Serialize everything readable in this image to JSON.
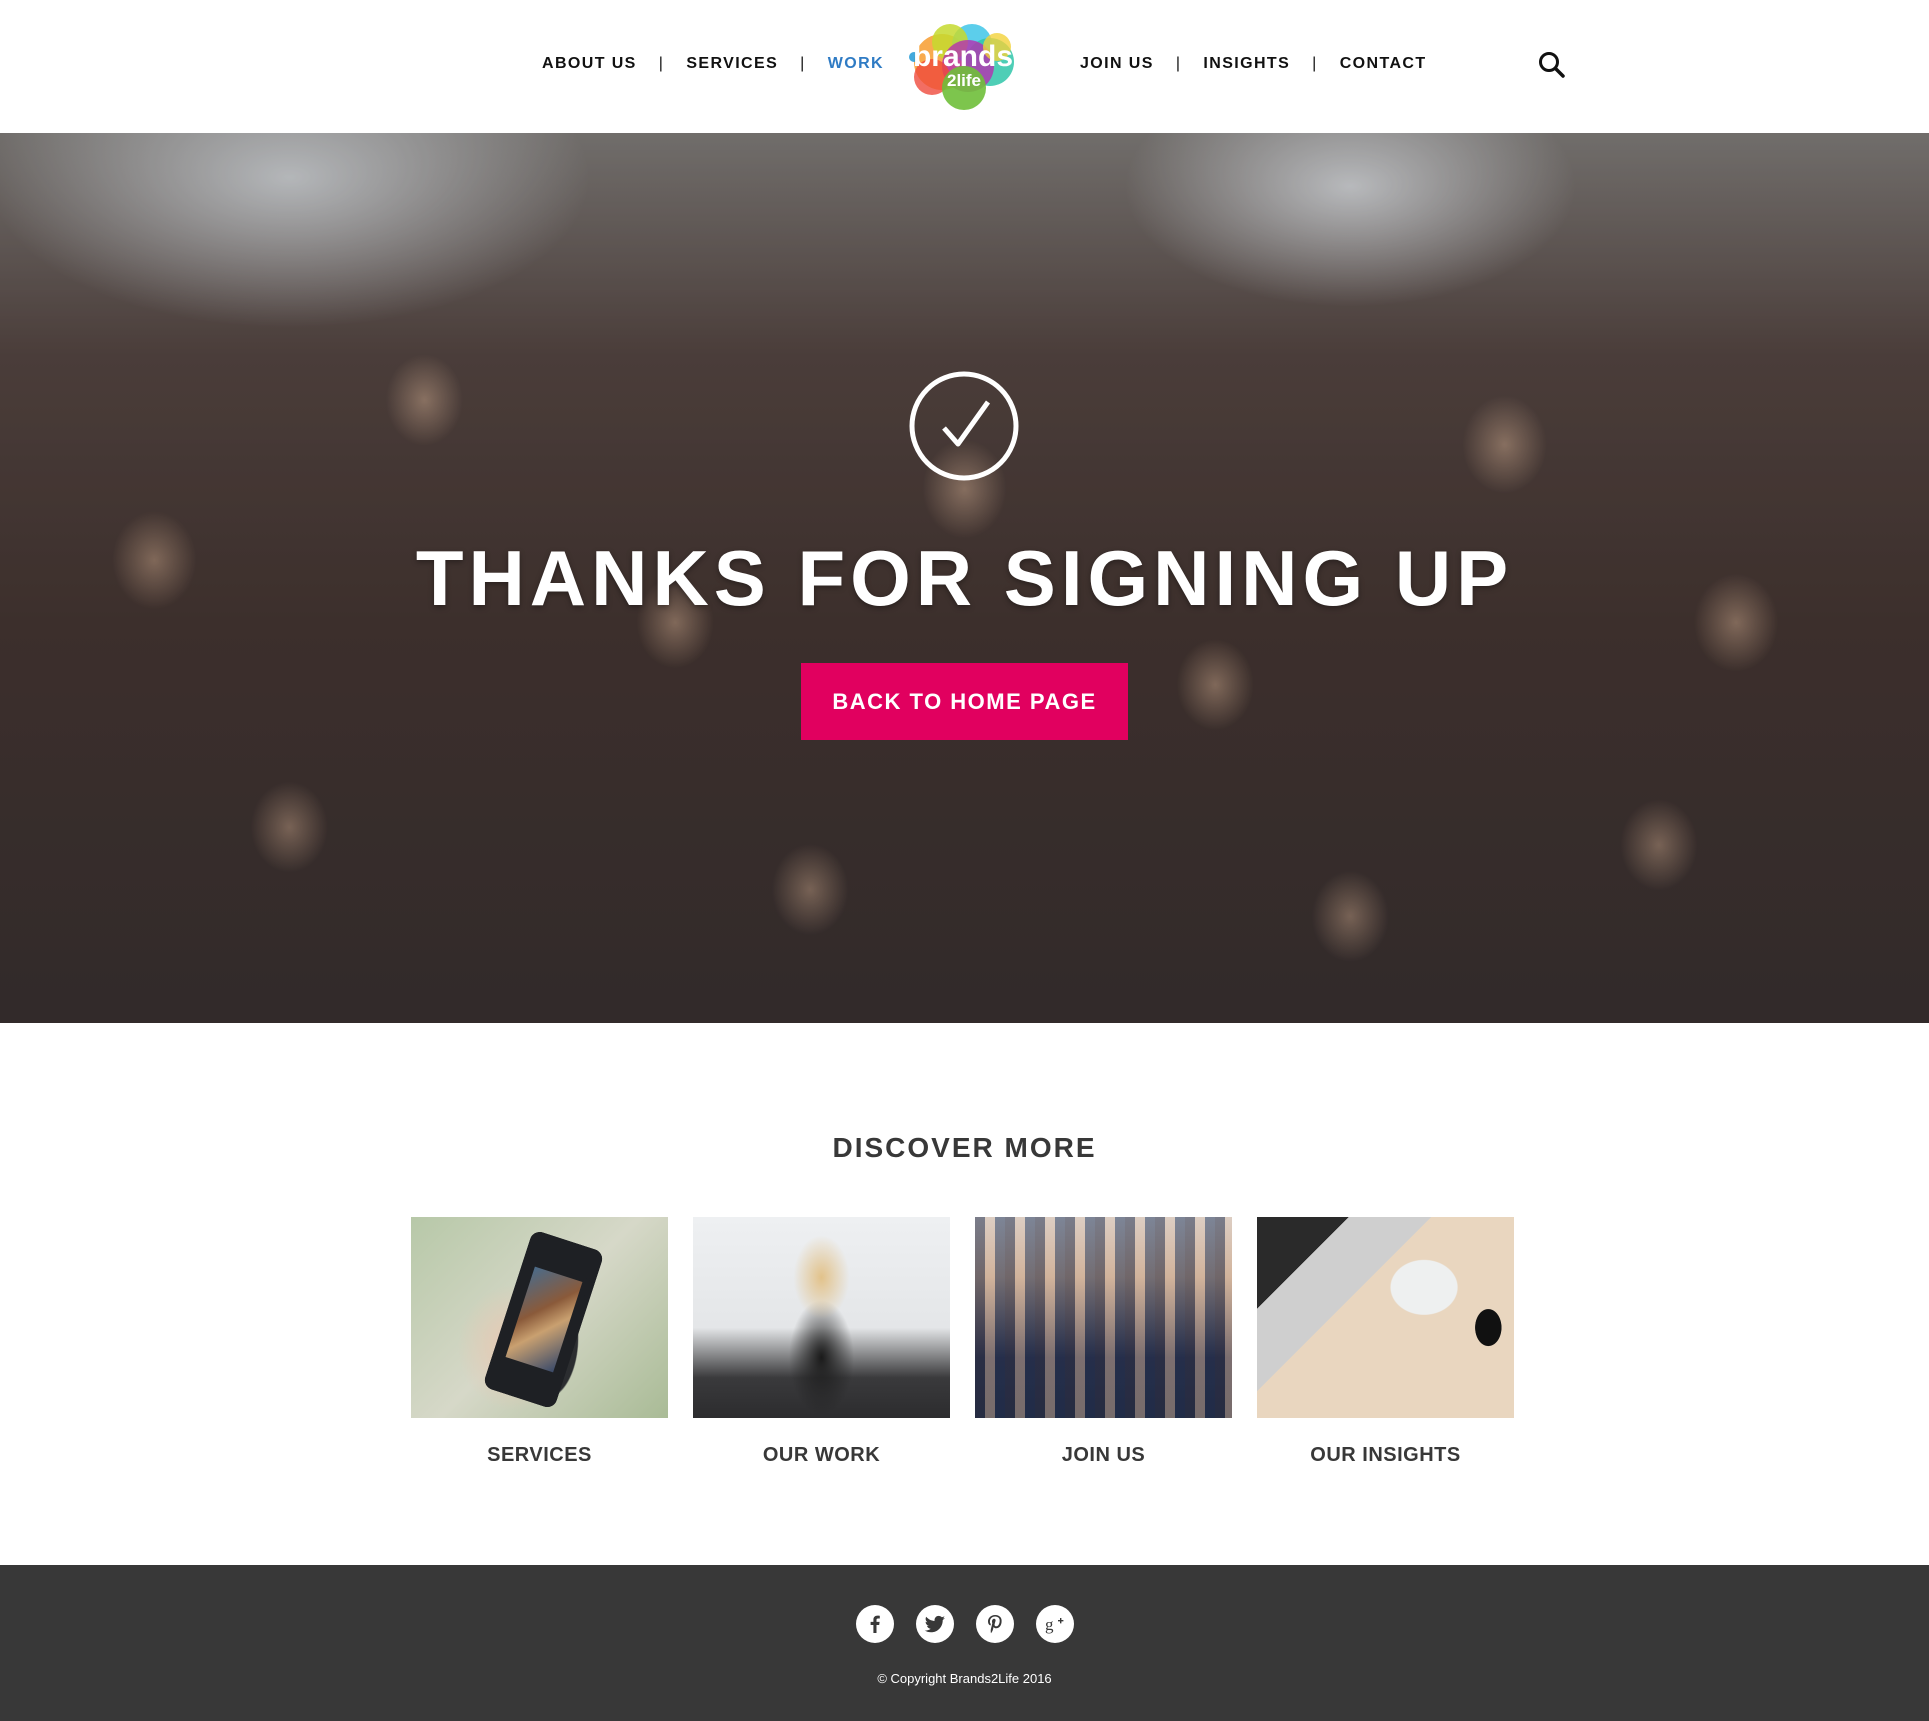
{
  "brand": {
    "logo_text_top": "brands",
    "logo_text_bottom": "2life"
  },
  "nav": {
    "left": [
      {
        "label": "ABOUT US",
        "active": false
      },
      {
        "label": "SERVICES",
        "active": false
      },
      {
        "label": "WORK",
        "active": true
      }
    ],
    "right": [
      {
        "label": "JOIN US",
        "active": false
      },
      {
        "label": "INSIGHTS",
        "active": false
      },
      {
        "label": "CONTACT",
        "active": false
      }
    ],
    "separator": "|",
    "search_icon": "search-icon",
    "active_color": "#2f7bc4"
  },
  "hero": {
    "icon": "check-circle-icon",
    "title": "THANKS FOR SIGNING UP",
    "button_label": "BACK TO HOME PAGE",
    "button_color": "#e1005f"
  },
  "discover": {
    "title": "DISCOVER MORE",
    "cards": [
      {
        "label": "SERVICES"
      },
      {
        "label": "OUR WORK"
      },
      {
        "label": "JOIN US"
      },
      {
        "label": "OUR INSIGHTS"
      }
    ]
  },
  "footer": {
    "socials": [
      "facebook-icon",
      "twitter-icon",
      "pinterest-icon",
      "google-plus-icon"
    ],
    "copyright": "© Copyright Brands2Life 2016",
    "background": "#383838"
  }
}
